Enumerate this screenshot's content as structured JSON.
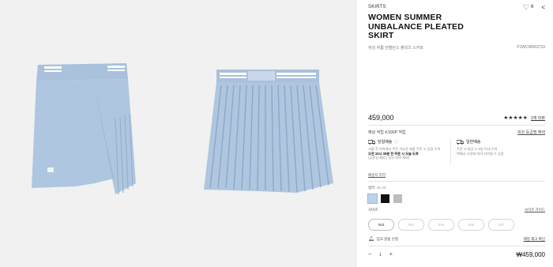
{
  "category": "SKIRTS",
  "wishlist_count": "6",
  "product": {
    "title": "WOMEN SUMMER UNBALANCE PLEATED SKIRT",
    "subtitle_kr": "여성 여름 언밸런스 플리츠 스커트",
    "code": "PJWCW563733",
    "price": "459,000",
    "stars": "★★★★★",
    "reviews": "3개 리뷰"
  },
  "points": {
    "label": "예상 적립 4,590P 적립",
    "link": "회원 등급별 혜택"
  },
  "shipping": {
    "option1": {
      "title": "당일배송",
      "line1": "서울 전 지역에서 주문 가능한 제품 주문 시 당일 도착",
      "line2": "오전 10시 30분 전 주문 시 오늘 도착",
      "line3": "(공휴일 제외 / 일부 지역 제외)"
    },
    "option2": {
      "title": "일반배송",
      "line1": "주문 시 평균 1~3일 이내 도착",
      "line2": "택배사 사정에 따라 지연될 수 있음"
    },
    "area_link": "배송지 지역"
  },
  "color": {
    "label": "컬러",
    "selected": "BLUE",
    "swatches": [
      "#bcd3ea",
      "#111111",
      "#bdbdbd"
    ]
  },
  "size": {
    "label": "사이즈",
    "guide_link": "사이즈 가이드",
    "options": [
      "063",
      "064",
      "065",
      "066",
      "067"
    ]
  },
  "notify": {
    "label": "입고 알림 신청",
    "link": "매장 재고 확인"
  },
  "quantity": {
    "minus": "−",
    "value": "1",
    "plus": "+"
  },
  "total": "₩459,000"
}
